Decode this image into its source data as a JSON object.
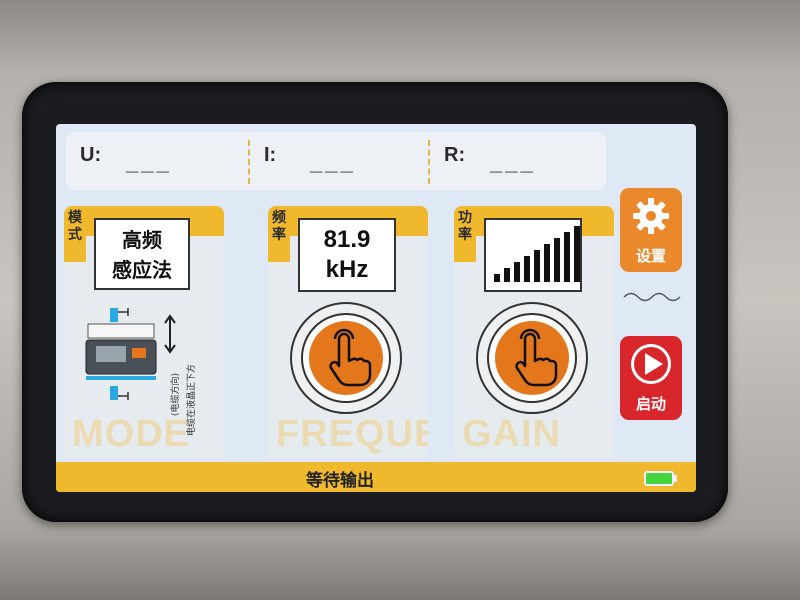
{
  "readouts": [
    {
      "label": "U:",
      "value": "___"
    },
    {
      "label": "I:",
      "value": "___"
    },
    {
      "label": "R:",
      "value": "___"
    }
  ],
  "mode": {
    "tab_label": "模式",
    "value_line1": "高频",
    "value_line2": "感应法",
    "side_arrow_text": "电缆在液晶正下方",
    "side_note": "(电缆方向)",
    "watermark": "MODE"
  },
  "frequency": {
    "tab_label": "频率",
    "value": "81.9",
    "unit": "kHz",
    "watermark": "FREQUE"
  },
  "gain": {
    "tab_label": "功率",
    "level_bars": 9,
    "watermark": "GAIN"
  },
  "sidebar": {
    "settings_label": "设置",
    "start_label": "启动"
  },
  "status": {
    "text": "等待输出"
  },
  "colors": {
    "accent": "#f0b92d",
    "button_orange": "#e4761c",
    "start_red": "#d8262a",
    "battery_green": "#45d43d"
  }
}
